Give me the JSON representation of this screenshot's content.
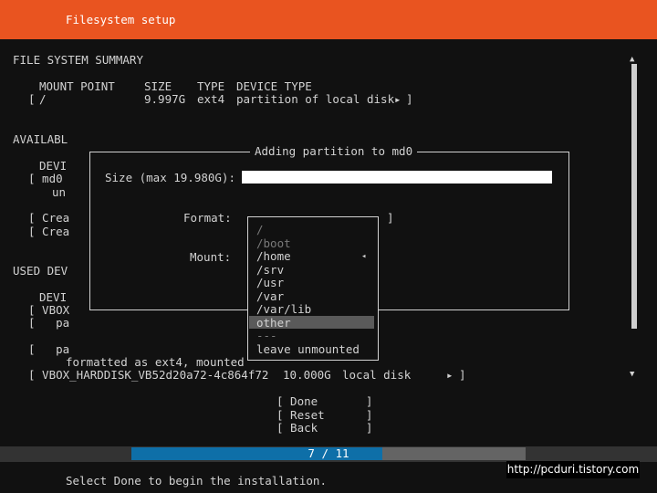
{
  "header": {
    "title": "Filesystem setup"
  },
  "summary": {
    "heading": "FILE SYSTEM SUMMARY",
    "col_mount": "MOUNT POINT",
    "col_size": "SIZE",
    "col_type": "TYPE",
    "col_device_type": "DEVICE TYPE",
    "row": {
      "open": "[",
      "mount": "/",
      "size": "9.997G",
      "type": "ext4",
      "device_type": "partition of local disk",
      "arrow": "▸",
      "close": "]"
    }
  },
  "available": {
    "heading": "AVAILABL",
    "col_device": "DEVI",
    "device": "[ md0",
    "device_sub": "un",
    "action1": "[ Crea",
    "action2": "[ Crea"
  },
  "used": {
    "heading": "USED DEV",
    "col_device": "DEVI",
    "device": "[ VBOX",
    "part1": "[   pa",
    "part2": "[   pa",
    "part2_info": "formatted as ext4, mounted",
    "disk_row": {
      "name": "[ VBOX_HARDDISK_VB52d20a72-4c864f72",
      "size": "10.000G",
      "type": "local disk",
      "arrow": "▸",
      "close": "]"
    }
  },
  "dialog": {
    "title": "Adding partition to md0",
    "size_label": "Size (max 19.980G):",
    "size_value": "",
    "format_label": "Format:",
    "format_close": "]",
    "mount_label": "Mount:"
  },
  "dropdown": {
    "options": [
      "/",
      "/boot",
      "/home",
      "/srv",
      "/usr",
      "/var",
      "/var/lib",
      "other",
      "---",
      "leave unmounted"
    ],
    "selected": "other",
    "current_marker": "◂"
  },
  "buttons": {
    "done": "[ Done       ]",
    "reset": "[ Reset      ]",
    "back": "[ Back       ]"
  },
  "progress": {
    "text": "7 / 11",
    "current": 7,
    "total": 11
  },
  "status": "Select Done to begin the installation.",
  "watermark": "http://pcduri.tistory.com",
  "scroll": {
    "up": "▲",
    "down": "▼"
  },
  "colors": {
    "header": "#e95420",
    "progress": "#0e6fa8",
    "background": "#111111"
  }
}
